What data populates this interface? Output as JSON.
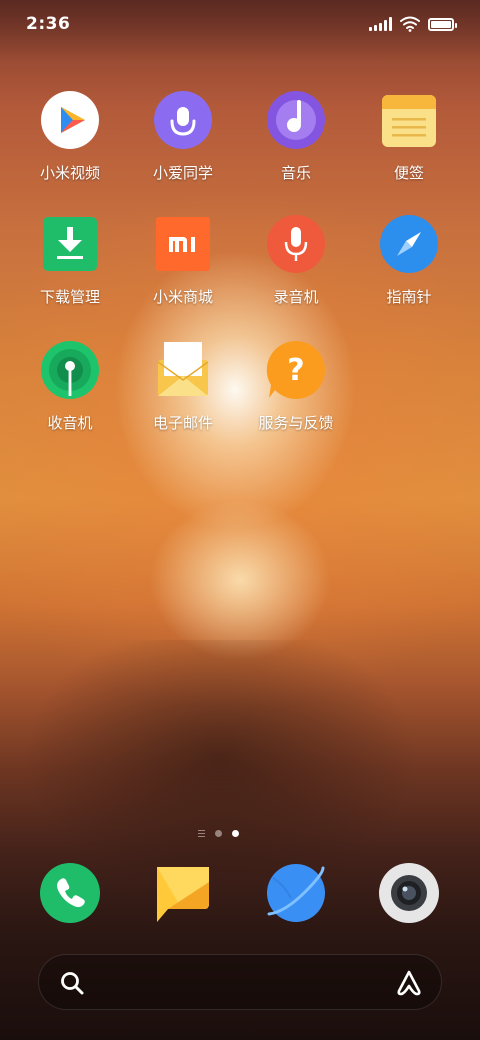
{
  "status_bar": {
    "time": "2:36",
    "battery_level": 1.0
  },
  "apps": [
    {
      "label": "小米视频",
      "icon": "play-icon",
      "color": "#ffffff"
    },
    {
      "label": "小爱同学",
      "icon": "xiaoai-icon",
      "color": "#8b6cf0"
    },
    {
      "label": "音乐",
      "icon": "music-note-icon",
      "color": "#8455e0"
    },
    {
      "label": "便签",
      "icon": "notes-icon",
      "color": "#f8c542"
    },
    {
      "label": "下载管理",
      "icon": "download-icon",
      "color": "#1fbd6a"
    },
    {
      "label": "小米商城",
      "icon": "mi-store-icon",
      "color": "#ff6a2c"
    },
    {
      "label": "录音机",
      "icon": "microphone-icon",
      "color": "#ef5a3c"
    },
    {
      "label": "指南针",
      "icon": "compass-icon",
      "color": "#2c8fee"
    },
    {
      "label": "收音机",
      "icon": "radio-icon",
      "color": "#1ec46c"
    },
    {
      "label": "电子邮件",
      "icon": "mail-icon",
      "color": "#f7c64b"
    },
    {
      "label": "服务与反馈",
      "icon": "help-icon",
      "color": "#fb9c1e"
    }
  ],
  "pager": {
    "pages": 3,
    "current": 3
  },
  "dock": [
    {
      "icon": "phone-icon",
      "color": "#1fbd6a"
    },
    {
      "icon": "message-icon",
      "color": "#ffc93a"
    },
    {
      "icon": "browser-icon",
      "color": "#3a8ff4"
    },
    {
      "icon": "camera-icon",
      "color": "#e6e6e6"
    }
  ],
  "search": {
    "left_icon": "search-icon",
    "right_icon": "assistant-icon"
  }
}
